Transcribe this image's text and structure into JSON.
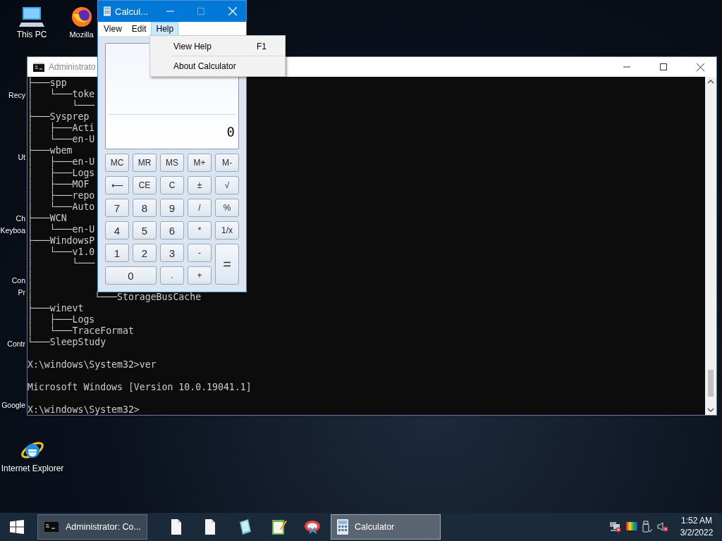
{
  "desktop_icons": [
    {
      "label": [
        "This PC"
      ],
      "kind": "pc"
    },
    {
      "label": [
        "Mozilla"
      ],
      "kind": "firefox"
    },
    {
      "label": [
        "Recy"
      ],
      "kind": "none"
    },
    {
      "label": [
        "Ut"
      ],
      "kind": "none"
    },
    {
      "label": [
        "Ch",
        "Keyboa"
      ],
      "kind": "none"
    },
    {
      "label": [
        "Con",
        "Pr"
      ],
      "kind": "none"
    },
    {
      "label": [
        "Contr"
      ],
      "kind": "none"
    },
    {
      "label": [
        "Google"
      ],
      "kind": "none"
    },
    {
      "label": [
        "Internet Explorer"
      ],
      "kind": "ie"
    }
  ],
  "console": {
    "title": "Administrato",
    "blocks": [
      [
        {
          "text": "├───spp"
        },
        {
          "text": "│   └───toke"
        },
        {
          "text": "│       └───"
        },
        {
          "text": "├───Sysprep"
        },
        {
          "text": "│   ├───Acti"
        },
        {
          "text": "│   └───en-U"
        },
        {
          "text": "├───wbem"
        },
        {
          "text": "│   ├───en-U"
        },
        {
          "text": "│   ├───Logs"
        },
        {
          "text": "│   ├───MOF"
        },
        {
          "text": "│   ├───repo"
        },
        {
          "text": "│   └───Auto"
        },
        {
          "text": "├───WCN"
        },
        {
          "text": "│   └───en-U"
        },
        {
          "text": "├───WindowsP"
        },
        {
          "text": "│   └───v1.0"
        },
        {
          "text": "│       └───"
        },
        {
          "text": "│"
        },
        {
          "text": "│"
        },
        {
          "text": "│           └───StorageBusCache"
        },
        {
          "text": "├───winevt"
        },
        {
          "text": "│   ├───Logs"
        },
        {
          "text": "│   └───TraceFormat"
        },
        {
          "text": "└───SleepStudy"
        }
      ],
      [
        {
          "text": "X:\\windows\\System32>ver"
        }
      ],
      [
        {
          "text": "Microsoft Windows [Version 10.0.19041.1]"
        }
      ],
      [
        {
          "text": "X:\\windows\\System32>"
        }
      ]
    ]
  },
  "calculator": {
    "title": "Calcul...",
    "menu": [
      {
        "label": "View",
        "selected": false
      },
      {
        "label": "Edit",
        "selected": false
      },
      {
        "label": "Help",
        "selected": true
      }
    ],
    "help_menu": [
      {
        "label": "View Help",
        "shortcut": "F1"
      },
      {
        "label": "About Calculator"
      }
    ],
    "display": "0",
    "buttons": [
      {
        "label": "MC"
      },
      {
        "label": "MR"
      },
      {
        "label": "MS"
      },
      {
        "label": "M+"
      },
      {
        "label": "M-"
      },
      {
        "label": "⟵"
      },
      {
        "label": "CE"
      },
      {
        "label": "C"
      },
      {
        "label": "±"
      },
      {
        "label": "√"
      },
      {
        "label": "7"
      },
      {
        "label": "8"
      },
      {
        "label": "9"
      },
      {
        "label": "/"
      },
      {
        "label": "%"
      },
      {
        "label": "4"
      },
      {
        "label": "5"
      },
      {
        "label": "6"
      },
      {
        "label": "*"
      },
      {
        "label": "1/x"
      },
      {
        "label": "1"
      },
      {
        "label": "2"
      },
      {
        "label": "3"
      },
      {
        "label": "-"
      },
      {
        "label": "=",
        "tall": true
      },
      {
        "label": "0",
        "wide": true
      },
      {
        "label": "."
      },
      {
        "label": "+"
      }
    ]
  },
  "taskbar": {
    "windows": [
      {
        "label": "Administrator: Co...",
        "kind": "console",
        "selected": false
      },
      {
        "label": "Calculator",
        "kind": "calculator",
        "selected": true
      }
    ],
    "time": "1:52 AM",
    "date": "3/2/2022"
  }
}
